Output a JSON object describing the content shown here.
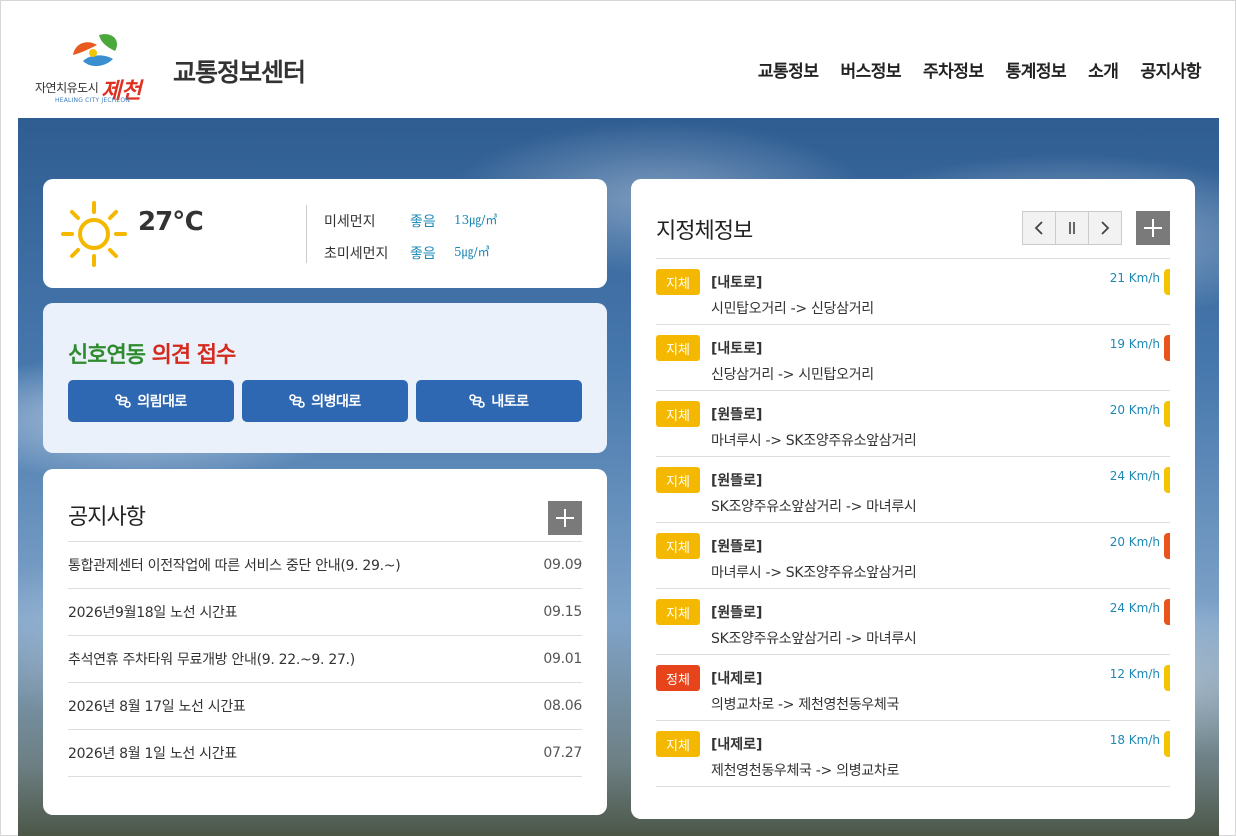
{
  "header": {
    "logo_text": "자연치유도시",
    "logo_jecheon": "제천",
    "logo_sub": "HEALING CITY JECHEON",
    "site_title": "교통정보센터",
    "nav": [
      "교통정보",
      "버스정보",
      "주차정보",
      "통계정보",
      "소개",
      "공지사항"
    ]
  },
  "weather": {
    "icon": "sun-icon",
    "temperature": "27℃",
    "fine_dust": {
      "label": "미세먼지",
      "status": "좋음",
      "value": "13㎍/㎥"
    },
    "ultrafine_dust": {
      "label": "초미세먼지",
      "status": "좋음",
      "value": "5㎍/㎥"
    }
  },
  "signal": {
    "title_green": "신호연동",
    "title_red": "의견 접수",
    "buttons": [
      "의림대로",
      "의병대로",
      "내토로"
    ]
  },
  "notice": {
    "title": "공지사항",
    "items": [
      {
        "title": "통합관제센터 이전작업에 따른 서비스 중단 안내(9. 29.~)",
        "date": "09.09"
      },
      {
        "title": "2026년9월18일 노선 시간표",
        "date": "09.15"
      },
      {
        "title": "추석연휴 주차타워 무료개방 안내(9. 22.~9. 27.)",
        "date": "09.01"
      },
      {
        "title": "2026년 8월 17일 노선 시간표",
        "date": "08.06"
      },
      {
        "title": "2026년 8월 1일 노선 시간표",
        "date": "07.27"
      }
    ]
  },
  "designated": {
    "title": "지정체정보",
    "colors": {
      "slow": "#f5b800",
      "jam": "#e8441c",
      "speed_text": "#1e88b5"
    },
    "items": [
      {
        "status": "지체",
        "road": "[내토로]",
        "route": "시민탑오거리 -> 신당삼거리",
        "speed": "21 Km/h",
        "bar": "y",
        "badge": "slow"
      },
      {
        "status": "지체",
        "road": "[내토로]",
        "route": "신당삼거리 -> 시민탑오거리",
        "speed": "19 Km/h",
        "bar": "o",
        "badge": "slow"
      },
      {
        "status": "지체",
        "road": "[원뜰로]",
        "route": "마녀루시 -> SK조양주유소앞삼거리",
        "speed": "20 Km/h",
        "bar": "y",
        "badge": "slow"
      },
      {
        "status": "지체",
        "road": "[원뜰로]",
        "route": "SK조양주유소앞삼거리 -> 마녀루시",
        "speed": "24 Km/h",
        "bar": "y",
        "badge": "slow"
      },
      {
        "status": "지체",
        "road": "[원뜰로]",
        "route": "마녀루시 -> SK조양주유소앞삼거리",
        "speed": "20 Km/h",
        "bar": "o",
        "badge": "slow"
      },
      {
        "status": "지체",
        "road": "[원뜰로]",
        "route": "SK조양주유소앞삼거리 -> 마녀루시",
        "speed": "24 Km/h",
        "bar": "o",
        "badge": "slow"
      },
      {
        "status": "정체",
        "road": "[내제로]",
        "route": "의병교차로 -> 제천영천동우체국",
        "speed": "12 Km/h",
        "bar": "y",
        "badge": "jam"
      },
      {
        "status": "지체",
        "road": "[내제로]",
        "route": "제천영천동우체국 -> 의병교차로",
        "speed": "18 Km/h",
        "bar": "y",
        "badge": "slow"
      }
    ]
  }
}
